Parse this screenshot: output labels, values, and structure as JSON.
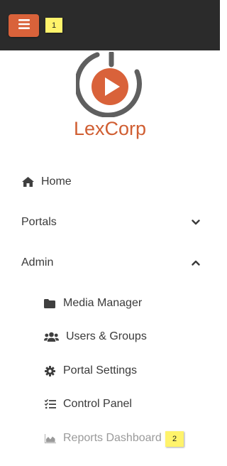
{
  "topbar": {
    "menu_icon": "hamburger-menu-icon",
    "badge_1": "1"
  },
  "brand": {
    "name": "LexCorp",
    "logo_icon": "play-logo-icon",
    "accent_color": "#d05e32"
  },
  "nav": {
    "home": {
      "label": "Home",
      "icon": "home-icon"
    },
    "portals": {
      "label": "Portals",
      "icon": "chevron-down-icon"
    },
    "admin": {
      "label": "Admin",
      "icon": "chevron-up-icon"
    },
    "admin_items": {
      "media": {
        "label": "Media Manager",
        "icon": "folder-icon"
      },
      "users": {
        "label": "Users & Groups",
        "icon": "users-icon"
      },
      "portal_settings": {
        "label": "Portal Settings",
        "icon": "gear-icon"
      },
      "control_panel": {
        "label": "Control Panel",
        "icon": "checklist-icon"
      },
      "reports": {
        "label": "Reports Dashboard",
        "icon": "area-chart-icon"
      }
    }
  },
  "annotations": {
    "badge_2": "2"
  }
}
